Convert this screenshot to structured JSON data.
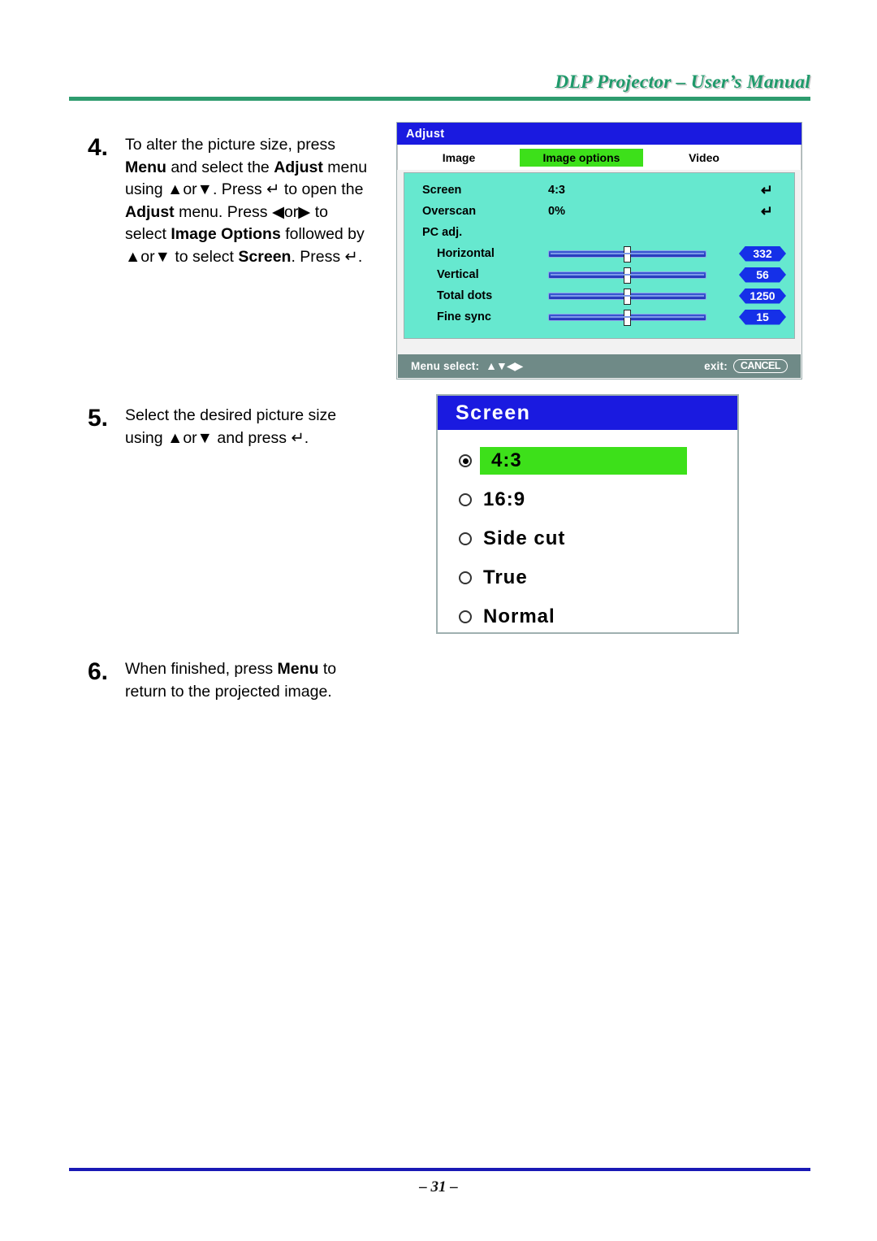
{
  "header": {
    "title": "DLP Projector – User’s Manual"
  },
  "footer": {
    "page_number": "– 31 –"
  },
  "steps": [
    {
      "number": "4.",
      "html_text": "To alter the picture size, press <b>Menu</b> and select the <b>Adjust</b> menu using ▲or▼. Press ↵ to open the <b>Adjust</b> menu. Press ◀or▶ to select <b>Image Options</b> followed by ▲or▼ to select <b>Screen</b>. Press ↵."
    },
    {
      "number": "5.",
      "html_text": "Select the desired picture size using ▲or▼ and press ↵."
    },
    {
      "number": "6.",
      "html_text": "When finished, press <b>Menu</b> to return to the projected image."
    }
  ],
  "osd_adjust": {
    "title": "Adjust",
    "tabs": [
      {
        "label": "Image",
        "selected": false
      },
      {
        "label": "Image options",
        "selected": true
      },
      {
        "label": "Video",
        "selected": false
      }
    ],
    "rows": [
      {
        "label": "Screen",
        "value": "4:3",
        "enter_icon": "↵",
        "type": "value"
      },
      {
        "label": "Overscan",
        "value": "0%",
        "enter_icon": "↵",
        "type": "value"
      },
      {
        "label": "PC adj.",
        "value": "",
        "type": "header"
      },
      {
        "label": "Horizontal",
        "badge": "332",
        "type": "slider"
      },
      {
        "label": "Vertical",
        "badge": "56",
        "type": "slider"
      },
      {
        "label": "Total dots",
        "badge": "1250",
        "type": "slider"
      },
      {
        "label": "Fine sync",
        "badge": "15",
        "type": "slider"
      }
    ],
    "status": {
      "left_label": "Menu select:",
      "arrows": "▲▼◀▶",
      "exit_label": "exit:",
      "cancel_label": "CANCEL"
    }
  },
  "screen_dialog": {
    "title": "Screen",
    "options": [
      {
        "label": "4:3",
        "selected": true
      },
      {
        "label": "16:9",
        "selected": false
      },
      {
        "label": "Side cut",
        "selected": false
      },
      {
        "label": "True",
        "selected": false
      },
      {
        "label": "Normal",
        "selected": false
      }
    ]
  },
  "colors": {
    "header_green": "#2e9c6e",
    "footer_blue": "#1a1ab5",
    "osd_title_blue": "#1a1ae0",
    "osd_content_cyan": "#66e8cf",
    "highlight_green": "#3de01a",
    "status_bar_gray": "#6f8a87",
    "slider_blue": "#1530e8"
  }
}
